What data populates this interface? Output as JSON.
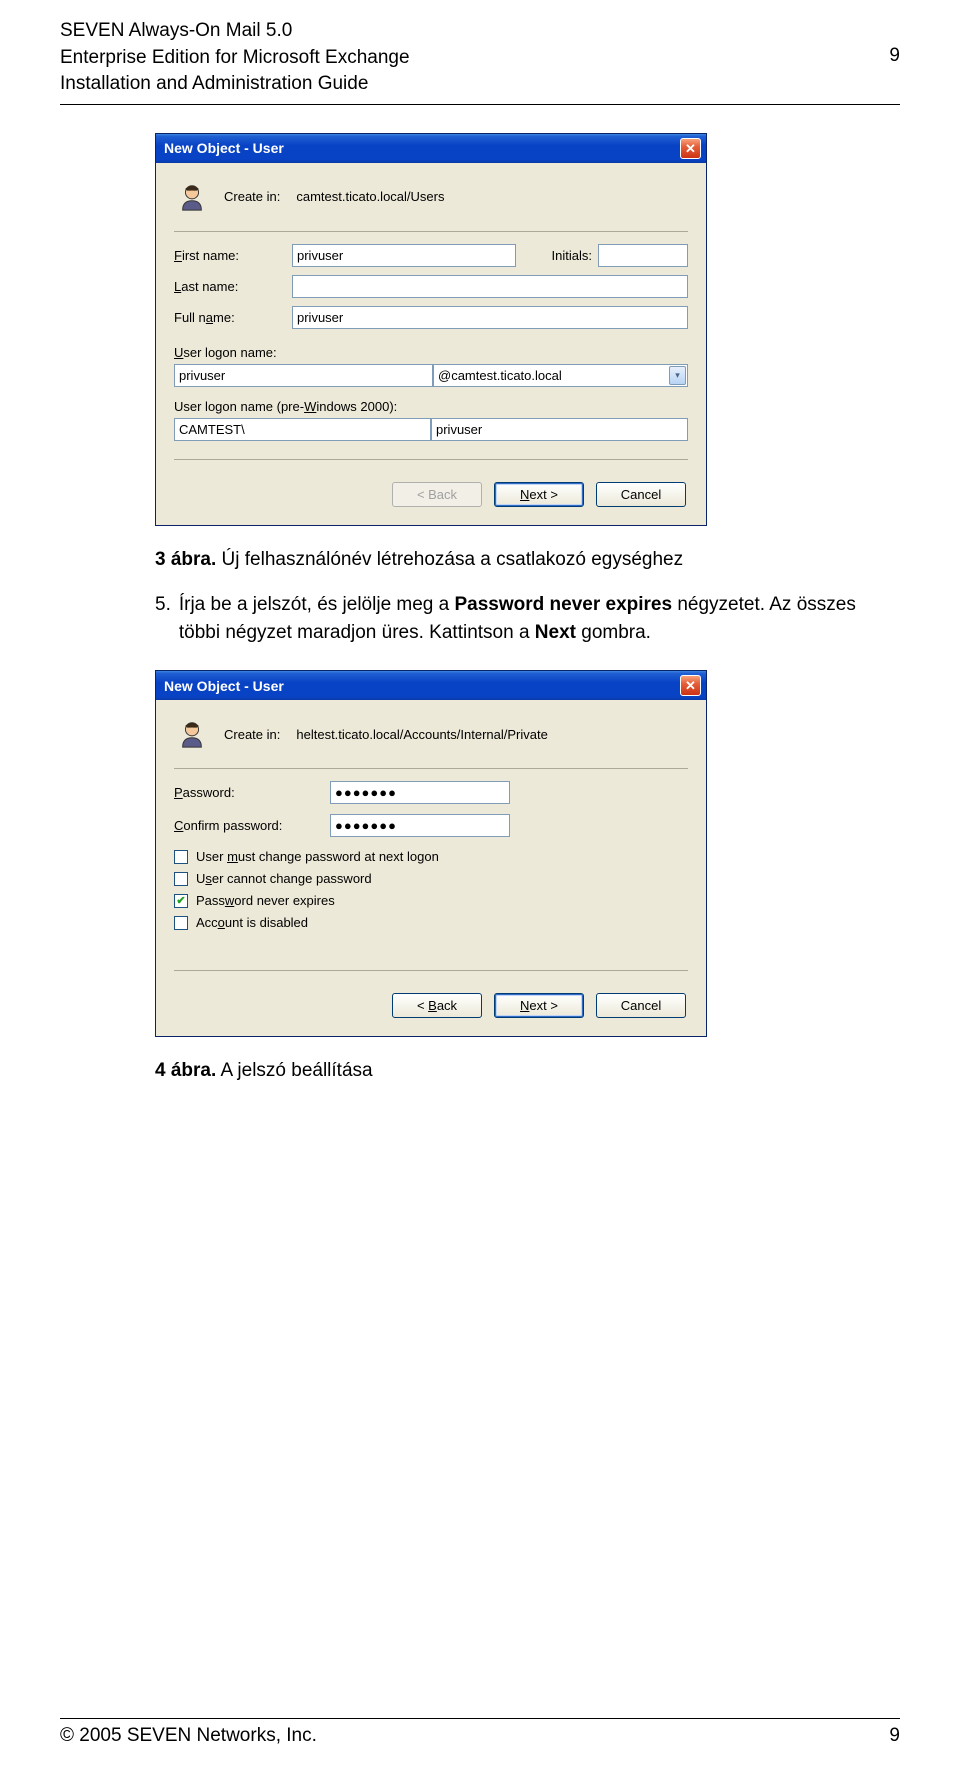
{
  "header": {
    "line1": "SEVEN Always-On Mail 5.0",
    "line2": "Enterprise Edition for Microsoft Exchange",
    "line3": "Installation and Administration Guide",
    "page_top": "9"
  },
  "dialog1": {
    "title": "New Object - User",
    "create_label": "Create in:",
    "create_path": "camtest.ticato.local/Users",
    "first_name_label": "First name:",
    "first_name_value": "privuser",
    "initials_label": "Initials:",
    "initials_value": "",
    "last_name_label": "Last name:",
    "last_name_value": "",
    "full_name_label": "Full name:",
    "full_name_value": "privuser",
    "logon_label": "User logon name:",
    "logon_value": "privuser",
    "domain_value": "@camtest.ticato.local",
    "pre2000_label": "User logon name (pre-Windows 2000):",
    "pre2000_prefix": "CAMTEST\\",
    "pre2000_value": "privuser",
    "back": "< Back",
    "next": "Next >",
    "cancel": "Cancel"
  },
  "caption1": {
    "prefix": "3 ábra.",
    "text": " Új felhasználónév létrehozása a csatlakozó egységhez"
  },
  "step5": {
    "num": "5.",
    "t1": "Írja be a jelszót, és jelölje meg a ",
    "b1": "Password never expires",
    "t2": " négyzetet. Az összes többi négyzet maradjon üres. Kattintson a ",
    "b2": "Next",
    "t3": " gombra."
  },
  "dialog2": {
    "title": "New Object - User",
    "create_label": "Create in:",
    "create_path": "heltest.ticato.local/Accounts/Internal/Private",
    "password_label": "Password:",
    "password_value": "●●●●●●●",
    "confirm_label": "Confirm password:",
    "confirm_value": "●●●●●●●",
    "chk1": "User must change password at next logon",
    "chk2": "User cannot change password",
    "chk3": "Password never expires",
    "chk4": "Account is disabled",
    "back": "< Back",
    "next": "Next >",
    "cancel": "Cancel"
  },
  "caption2": {
    "prefix": "4 ábra.",
    "text": " A jelszó beállítása"
  },
  "footer": {
    "copyright": "© 2005 SEVEN Networks, Inc.",
    "page": "9"
  }
}
